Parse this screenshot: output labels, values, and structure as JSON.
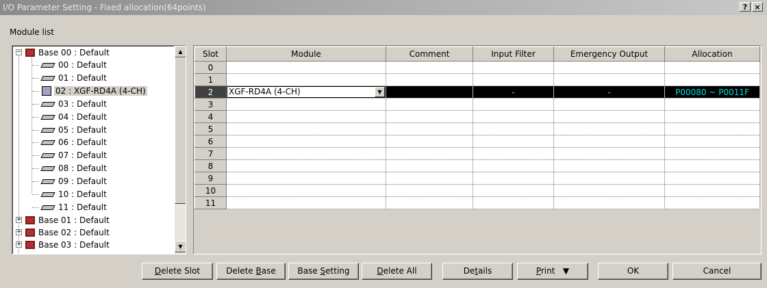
{
  "window": {
    "title": "I/O Parameter Setting - Fixed allocation(64points)",
    "help_label": "?",
    "close_label": "×"
  },
  "module_list_label": "Module list",
  "tree": {
    "base00": "Base 00 : Default",
    "children": [
      "00 : Default",
      "01 : Default",
      "02 :  XGF-RD4A (4-CH)",
      "03 : Default",
      "04 : Default",
      "05 : Default",
      "06 : Default",
      "07 : Default",
      "08 : Default",
      "09 : Default",
      "10 : Default",
      "11 : Default"
    ],
    "collapsed_bases": [
      "Base 01 : Default",
      "Base 02 : Default",
      "Base 03 : Default"
    ],
    "collapsed_expander": "+",
    "expanded_expander": "−"
  },
  "grid": {
    "headers": [
      "Slot",
      "Module",
      "Comment",
      "Input Filter",
      "Emergency Output",
      "Allocation"
    ],
    "slots": [
      "0",
      "1",
      "2",
      "3",
      "4",
      "5",
      "6",
      "7",
      "8",
      "9",
      "10",
      "11"
    ],
    "selected": {
      "module": "XGF-RD4A (4-CH)",
      "comment": "",
      "input_filter": "-",
      "emergency_output": "-",
      "allocation": "P00080 ~ P0011F"
    }
  },
  "buttons": {
    "delete_slot": {
      "pre": "",
      "ul": "D",
      "post": "elete Slot"
    },
    "delete_base": {
      "pre": "Delete ",
      "ul": "B",
      "post": "ase"
    },
    "base_setting": {
      "pre": "Base ",
      "ul": "S",
      "post": "etting"
    },
    "delete_all": {
      "pre": "",
      "ul": "D",
      "post": "elete All"
    },
    "details": {
      "pre": "De",
      "ul": "t",
      "post": "ails"
    },
    "print": {
      "pre": "",
      "ul": "P",
      "post": "rint"
    },
    "print_arrow": "▼",
    "ok": "OK",
    "cancel": "Cancel"
  }
}
